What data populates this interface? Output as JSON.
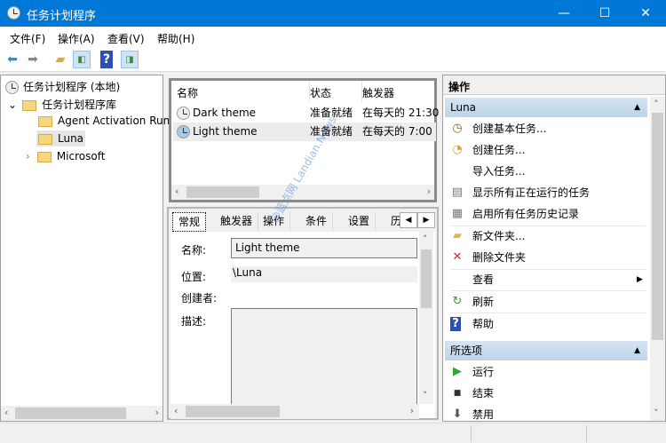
{
  "window": {
    "title": "任务计划程序",
    "minimize": "—",
    "maximize": "☐",
    "close": "✕"
  },
  "menu": [
    "文件(F)",
    "操作(A)",
    "查看(V)",
    "帮助(H)"
  ],
  "tree": {
    "root": "任务计划程序 (本地)",
    "library": "任务计划程序库",
    "children": [
      "Agent Activation Runtime",
      "Luna",
      "Microsoft"
    ]
  },
  "tasks": {
    "columns": [
      "名称",
      "状态",
      "触发器"
    ],
    "rows": [
      {
        "name": "Dark theme",
        "status": "准备就绪",
        "trigger": "在每天的 21:30"
      },
      {
        "name": "Light theme",
        "status": "准备就绪",
        "trigger": "在每天的 7:00"
      }
    ]
  },
  "details": {
    "tabs": [
      "常规",
      "触发器",
      "操作",
      "条件",
      "设置",
      "历"
    ],
    "name_label": "名称:",
    "name_value": "Light theme",
    "location_label": "位置:",
    "location_value": "\\Luna",
    "author_label": "创建者:",
    "desc_label": "描述:"
  },
  "actions": {
    "title": "操作",
    "section1": "Luna",
    "items1": [
      "创建基本任务...",
      "创建任务...",
      "导入任务...",
      "显示所有正在运行的任务",
      "启用所有任务历史记录",
      "新文件夹...",
      "删除文件夹",
      "查看",
      "刷新",
      "帮助"
    ],
    "section2": "所选项",
    "items2": [
      "运行",
      "结束",
      "禁用"
    ]
  },
  "watermark": "@蓝点网 Landian.News"
}
